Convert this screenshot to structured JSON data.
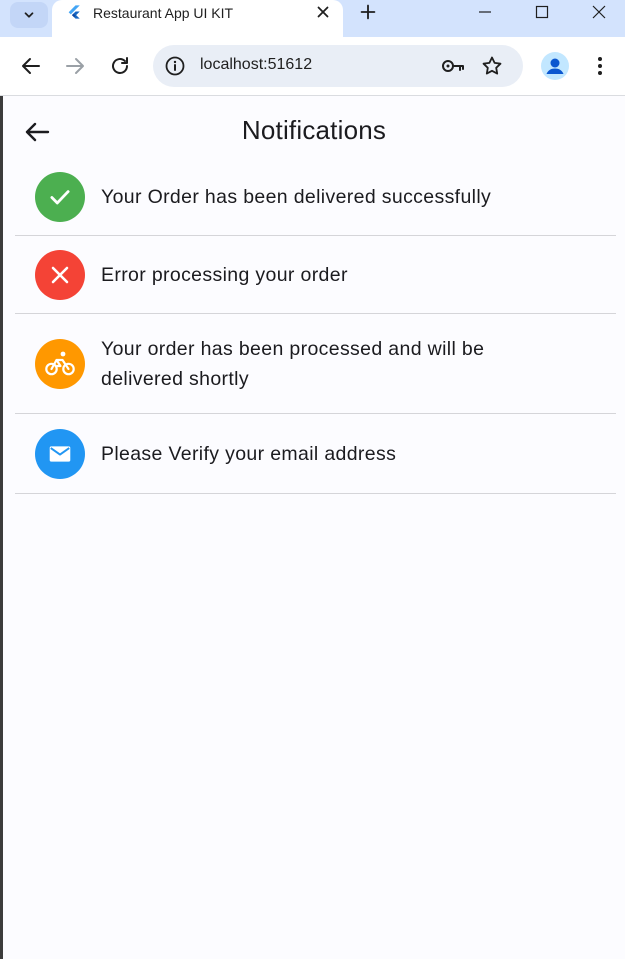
{
  "browser": {
    "tab_title": "Restaurant App UI KIT",
    "url": "localhost:51612"
  },
  "app": {
    "title": "Notifications"
  },
  "notifications": [
    {
      "message": "Your Order has been delivered successfully",
      "status": "success",
      "icon": "check-icon",
      "color": "#4caf50"
    },
    {
      "message": "Error processing your order",
      "status": "error",
      "icon": "close-icon",
      "color": "#f44336"
    },
    {
      "message": "Your order has been processed and will be delivered shortly",
      "status": "processing",
      "icon": "bicycle-icon",
      "color": "#ff9800"
    },
    {
      "message": "Please Verify your email address",
      "status": "info",
      "icon": "email-icon",
      "color": "#2196f3"
    }
  ],
  "colors": {
    "tabstrip": "#d3e3fd",
    "omnibox": "#e9eef6",
    "background": "#fcfcff",
    "divider": "#d5d5d9"
  }
}
